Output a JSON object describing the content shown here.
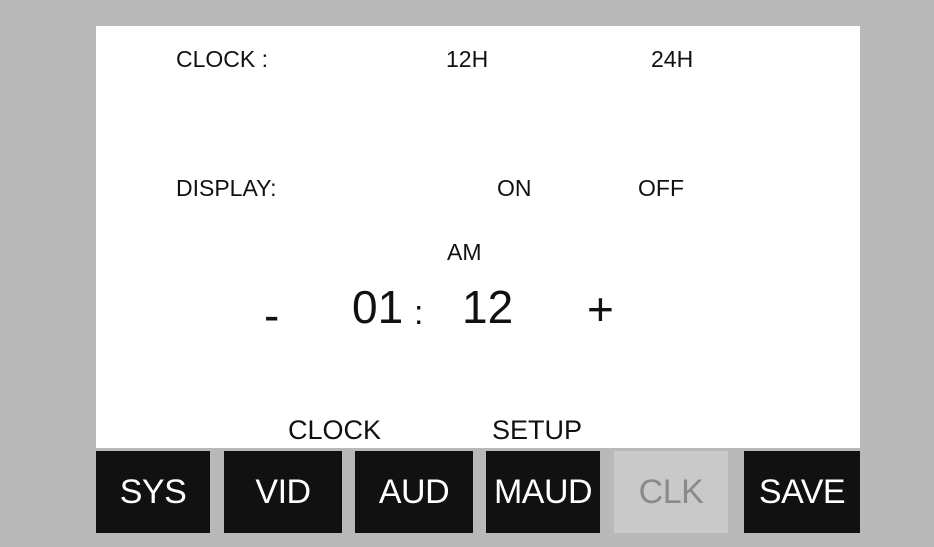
{
  "settings": {
    "clock_label": "CLOCK :",
    "clock_12h": "12H",
    "clock_24h": "24H",
    "display_label": "DISPLAY:",
    "display_on": "ON",
    "display_off": "OFF"
  },
  "time": {
    "period": "AM",
    "decrement": "-",
    "hours": "01",
    "separator": ":",
    "minutes": "12",
    "increment": "+"
  },
  "page_title": {
    "left": "CLOCK",
    "right": "SETUP"
  },
  "nav": {
    "sys": "SYS",
    "vid": "VID",
    "aud": "AUD",
    "maud": "MAUD",
    "clk": "CLK",
    "save": "SAVE",
    "active": "CLK"
  },
  "colors": {
    "bezel": "#b9b9b9",
    "screen": "#ffffff",
    "button": "#111111",
    "button_text": "#ffffff",
    "active_button": "#c9c9c9",
    "active_text": "#8a8a8a"
  }
}
